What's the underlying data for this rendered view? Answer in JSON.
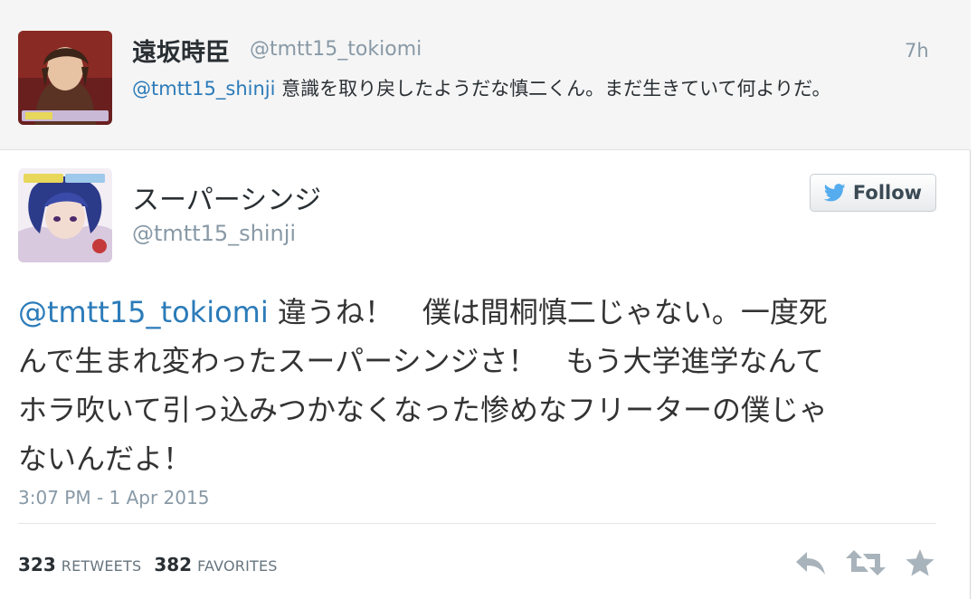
{
  "parent_tweet": {
    "avatar": "avatar",
    "name": "遠坂時臣",
    "handle": "@tmtt15_tokiomi",
    "time": "7h",
    "mention": "@tmtt15_shinji",
    "text": " 意識を取り戻したようだな慎二くん。まだ生きていて何よりだ。"
  },
  "main_tweet": {
    "avatar": "avatar",
    "name": "スーパーシンジ",
    "handle": "@tmtt15_shinji",
    "follow_label": "Follow",
    "mention": "@tmtt15_tokiomi",
    "lines": [
      " 違うね！　僕は間桐慎二じゃない。一度死",
      "んで生まれ変わったスーパーシンジさ！　もう大学進学なんて",
      "ホラ吹いて引っ込みつかなくなった惨めなフリーターの僕じゃ",
      "ないんだよ！"
    ],
    "timestamp": "3:07 PM - 1 Apr 2015",
    "retweets": "323",
    "retweets_label": "RETWEETS",
    "favorites": "382",
    "favorites_label": "FAVORITES"
  },
  "icons": {
    "follow": "twitter-bird-icon",
    "reply": "reply-icon",
    "retweet": "retweet-icon",
    "favorite": "star-icon"
  },
  "colors": {
    "link": "#2b7bb9",
    "muted": "#8899a6",
    "action_icon": "#a8b3bb",
    "twitter_blue": "#55acee"
  }
}
